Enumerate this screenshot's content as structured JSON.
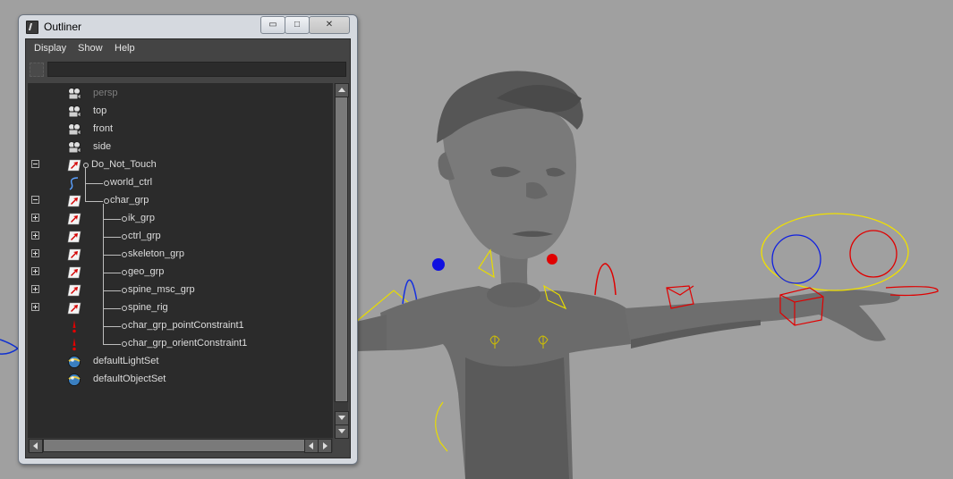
{
  "window": {
    "title": "Outliner",
    "minimize_glyph": "▭",
    "maximize_glyph": "□",
    "close_glyph": "✕"
  },
  "menu": [
    "Display",
    "Show",
    "Help"
  ],
  "filter": {
    "value": ""
  },
  "tree": [
    {
      "label": "persp",
      "icon": "camera-icon",
      "dim": true
    },
    {
      "label": "top",
      "icon": "camera-icon"
    },
    {
      "label": "front",
      "icon": "camera-icon"
    },
    {
      "label": "side",
      "icon": "camera-icon"
    },
    {
      "label": "Do_Not_Touch",
      "icon": "transform-group-icon",
      "expander": "minus"
    },
    {
      "label": "world_ctrl",
      "icon": "nurbs-curve-icon"
    },
    {
      "label": "char_grp",
      "icon": "transform-group-icon",
      "expander": "minus"
    },
    {
      "label": "ik_grp",
      "icon": "transform-group-icon",
      "expander": "plus"
    },
    {
      "label": "ctrl_grp",
      "icon": "transform-group-icon",
      "expander": "plus"
    },
    {
      "label": "skeleton_grp",
      "icon": "transform-group-icon",
      "expander": "plus"
    },
    {
      "label": "geo_grp",
      "icon": "transform-group-icon",
      "expander": "plus"
    },
    {
      "label": "spine_msc_grp",
      "icon": "transform-group-icon",
      "expander": "plus"
    },
    {
      "label": "spine_rig",
      "icon": "transform-group-icon",
      "expander": "plus"
    },
    {
      "label": "char_grp_pointConstraint1",
      "icon": "constraint-icon"
    },
    {
      "label": "char_grp_orientConstraint1",
      "icon": "constraint-icon"
    },
    {
      "label": "defaultLightSet",
      "icon": "set-sphere-icon"
    },
    {
      "label": "defaultObjectSet",
      "icon": "set-sphere-icon"
    }
  ],
  "colors": {
    "viewport_bg": "#a0a0a0",
    "panel_bg": "#444444",
    "list_bg": "#2b2b2b",
    "text": "#dcdcdc",
    "dim_text": "#7e7e7e",
    "control_yellow": "#f0e000",
    "control_red": "#e00000",
    "control_blue": "#0000e0"
  }
}
